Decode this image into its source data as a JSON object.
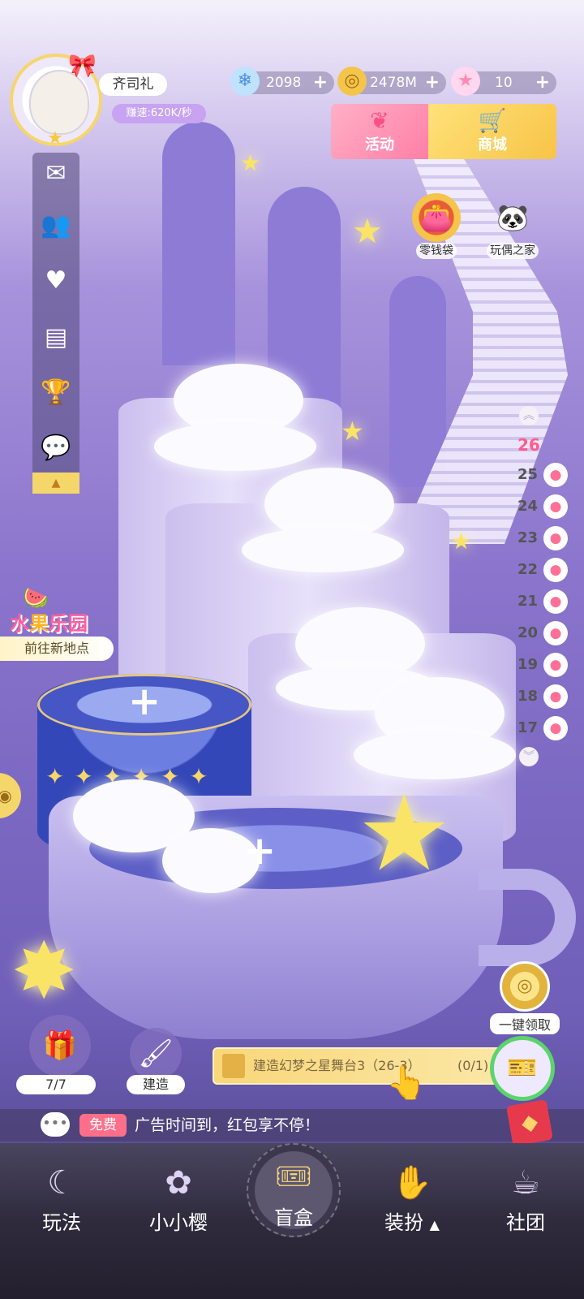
{
  "player": {
    "name": "齐司礼",
    "speed": "赚速:620K/秒"
  },
  "resources": [
    {
      "icon": "snowflake-gem-icon",
      "value": "2098"
    },
    {
      "icon": "gold-coin-stack-icon",
      "value": "2478M"
    },
    {
      "icon": "rainbow-star-icon",
      "value": "10"
    }
  ],
  "top_buttons": {
    "event": "活动",
    "shop": "商城"
  },
  "quick_access": {
    "wallet": "零钱袋",
    "doll_house": "玩偶之家"
  },
  "left_menu": [
    "mail-icon",
    "friends-icon",
    "pet-icon",
    "notice-board-icon",
    "trophy-icon",
    "chat-icon"
  ],
  "floors": {
    "current": "26",
    "list": [
      "25",
      "24",
      "23",
      "22",
      "21",
      "20",
      "19",
      "18",
      "17"
    ]
  },
  "location": {
    "title_pink_1": "水",
    "title_yellow": "果",
    "title_pink_2": "乐园",
    "goto": "前往新地点"
  },
  "gift": {
    "count": "7/7"
  },
  "build": {
    "label": "建造"
  },
  "claim_all": {
    "label": "一键领取"
  },
  "task": {
    "text": "建造幻梦之星舞台3（26-3）",
    "progress": "(0/1)"
  },
  "ad": {
    "free": "免费",
    "message": "广告时间到，红包享不停！"
  },
  "bottom_nav": {
    "play": "玩法",
    "xiaoxiaoying": "小小樱",
    "blindbox": "盲盒",
    "dressup": "装扮",
    "club": "社团"
  },
  "colors": {
    "accent_pink": "#ff7fa6",
    "accent_gold": "#f6d66b",
    "bg_purple": "#8a74cc"
  }
}
